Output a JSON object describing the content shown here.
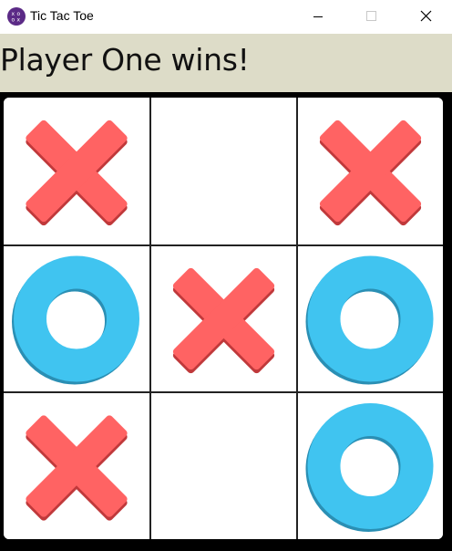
{
  "window": {
    "title": "Tic Tac Toe",
    "app_icon": "tic-tac-toe-app-icon",
    "buttons": {
      "minimize_icon": "minimize-icon",
      "maximize_icon": "maximize-icon",
      "close_icon": "close-icon"
    }
  },
  "status": {
    "message": "Player One wins!"
  },
  "colors": {
    "x_mark": "#ff6363",
    "o_mark": "#40c4f0",
    "status_background": "#dddcc8",
    "board_frame": "#000000",
    "grid_lines": "#222222"
  },
  "board": {
    "cells": [
      [
        "X",
        "",
        "X"
      ],
      [
        "O",
        "X",
        "O"
      ],
      [
        "X",
        "",
        "O"
      ]
    ]
  }
}
